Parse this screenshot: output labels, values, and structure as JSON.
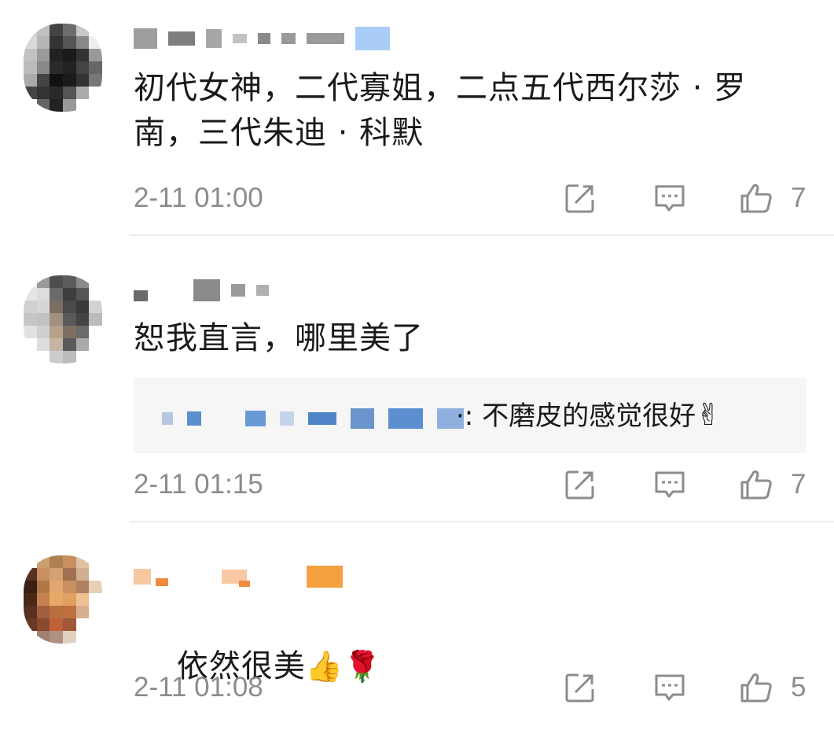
{
  "comments": [
    {
      "text": "初代女神，二代寡姐，二点五代西尔莎 · 罗南，三代朱迪 · 科默",
      "time": "2-11 01:00",
      "likes": "7"
    },
    {
      "text": "恕我直言，哪里美了",
      "reply_text": "·: 不磨皮的感觉很好",
      "reply_emoji": "✌",
      "time": "2-11 01:15",
      "likes": "7"
    },
    {
      "text": "依然很美",
      "emoji": "👍🌹",
      "time": "2-11 01:08",
      "likes": "5"
    }
  ],
  "icons": {
    "share": "share-icon",
    "reply": "comment-icon",
    "like": "thumbs-up-icon"
  },
  "colors": {
    "meta_gray": "#8c8c8c",
    "divider": "#ececec",
    "reply_bg": "#f6f6f6",
    "link_blue": "#5b8fd0"
  }
}
